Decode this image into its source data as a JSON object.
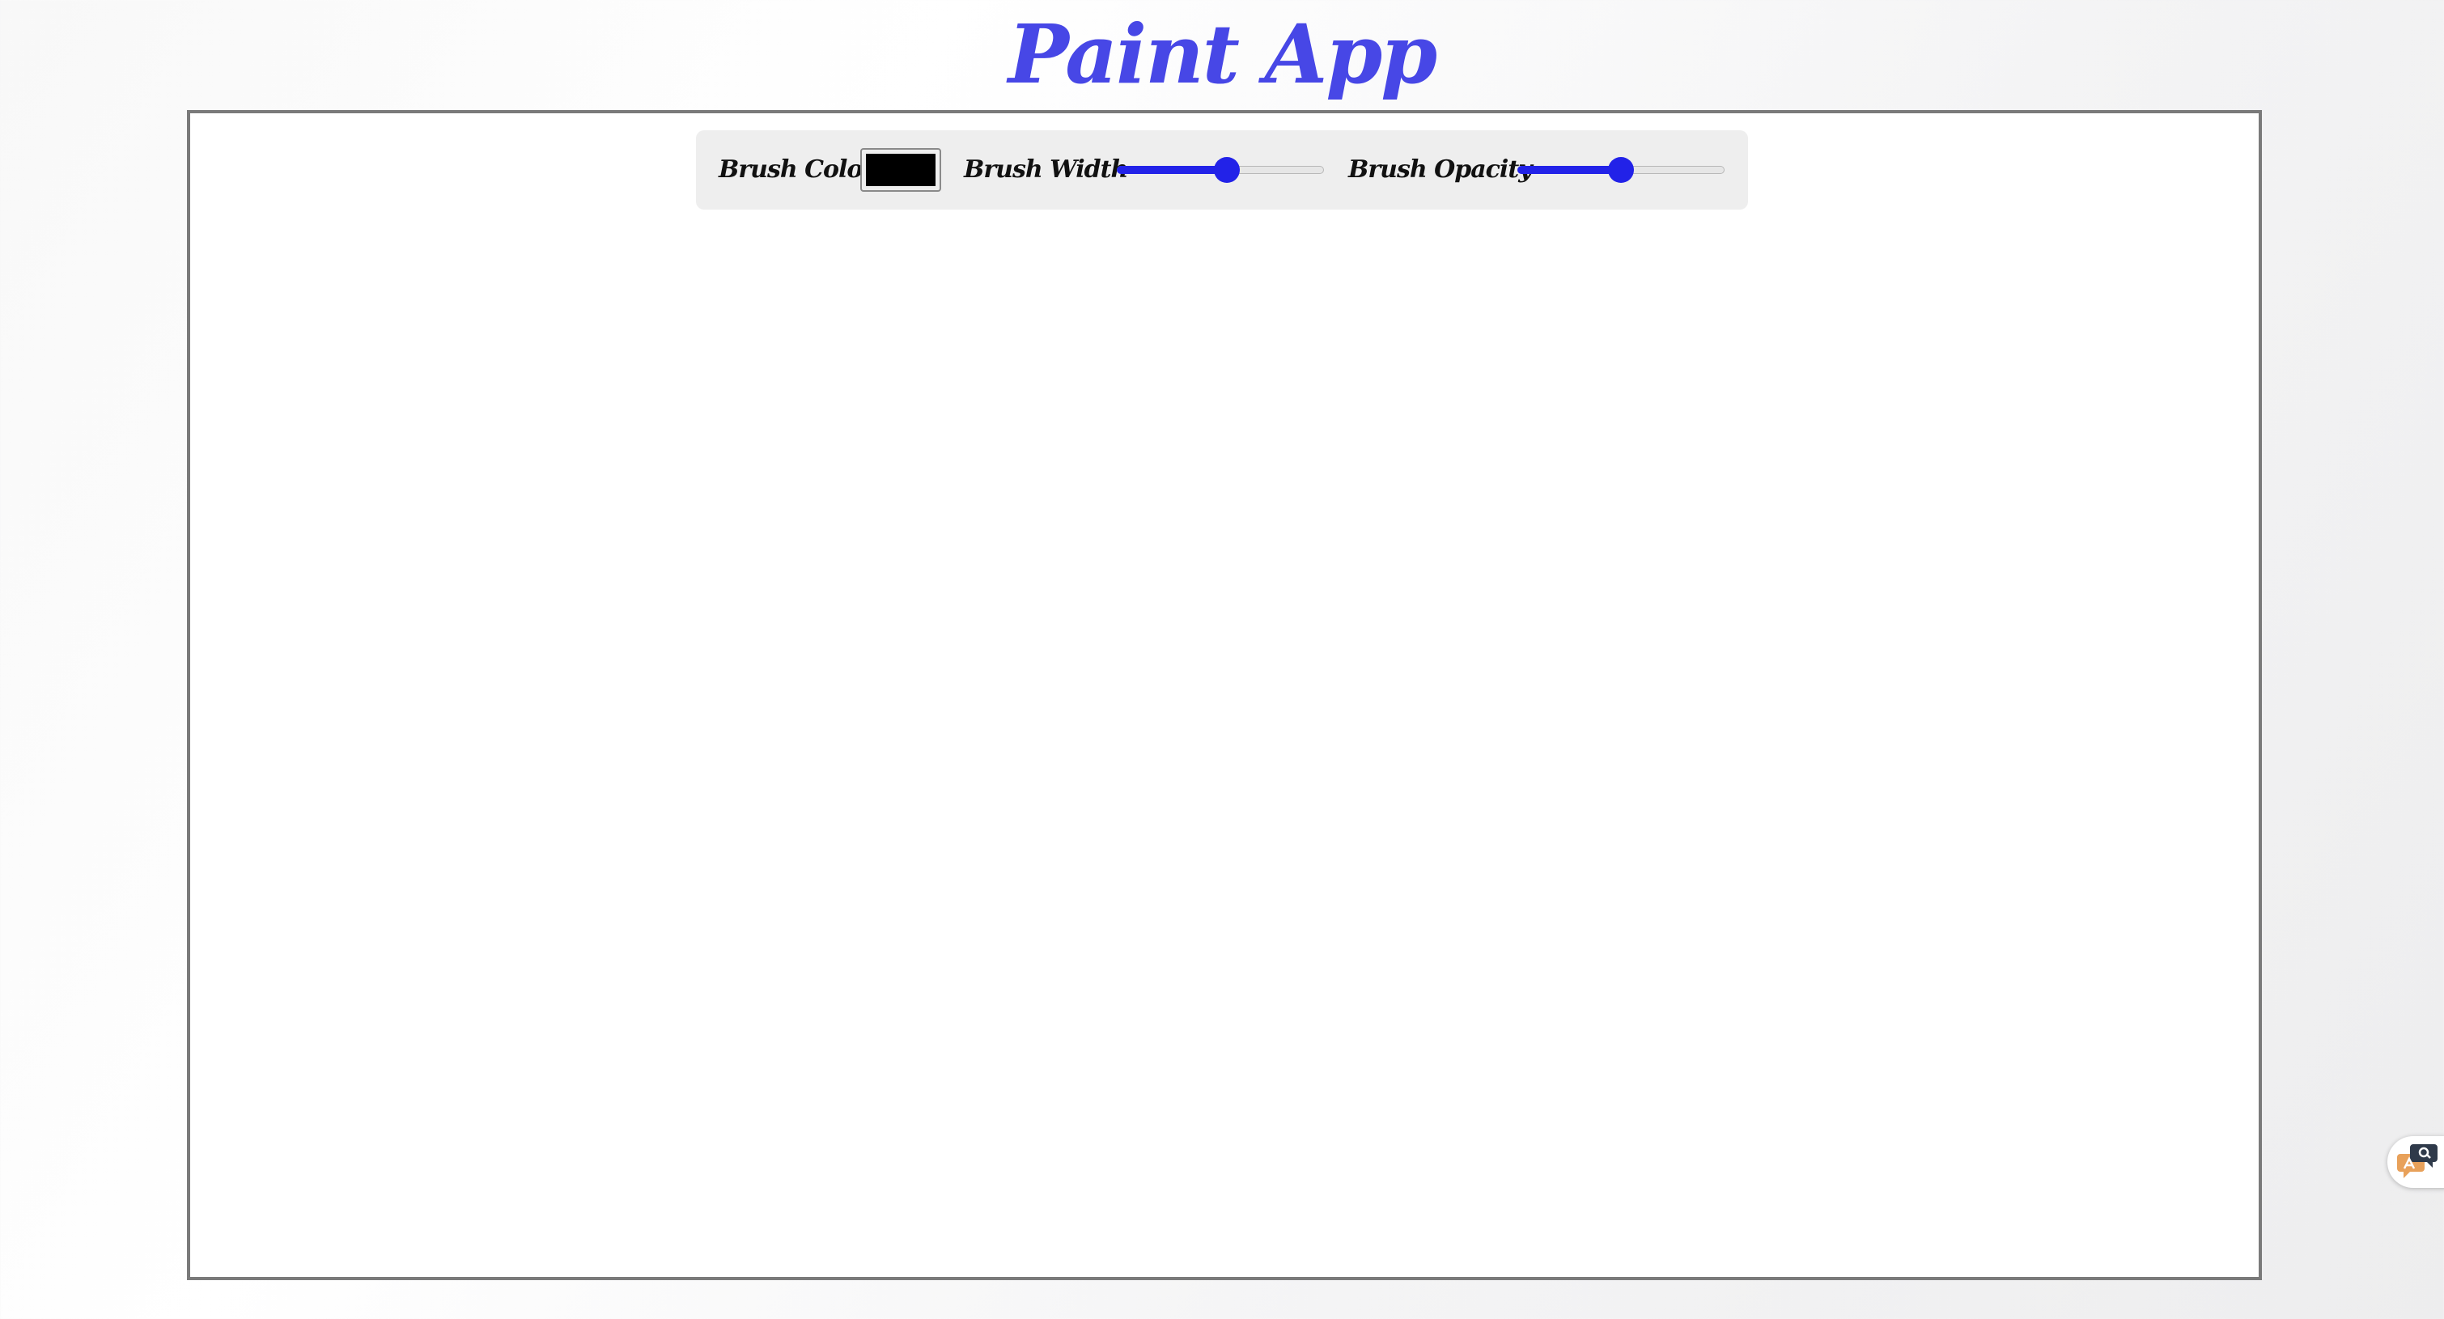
{
  "app": {
    "title": "Paint App",
    "title_color": "#4747e6"
  },
  "toolbar": {
    "brush_color_label": "Brush Color",
    "brush_color_value": "#000000",
    "brush_width_label": "Brush Width",
    "brush_width_level": 0.53,
    "brush_opacity_label": "Brush Opacity",
    "brush_opacity_level": 0.5,
    "slider_accent": "#2222e8"
  },
  "canvas": {
    "background": "#ffffff",
    "border_color": "#7a7a7a"
  },
  "side_widget": {
    "icon": "chat-translate-icon"
  }
}
